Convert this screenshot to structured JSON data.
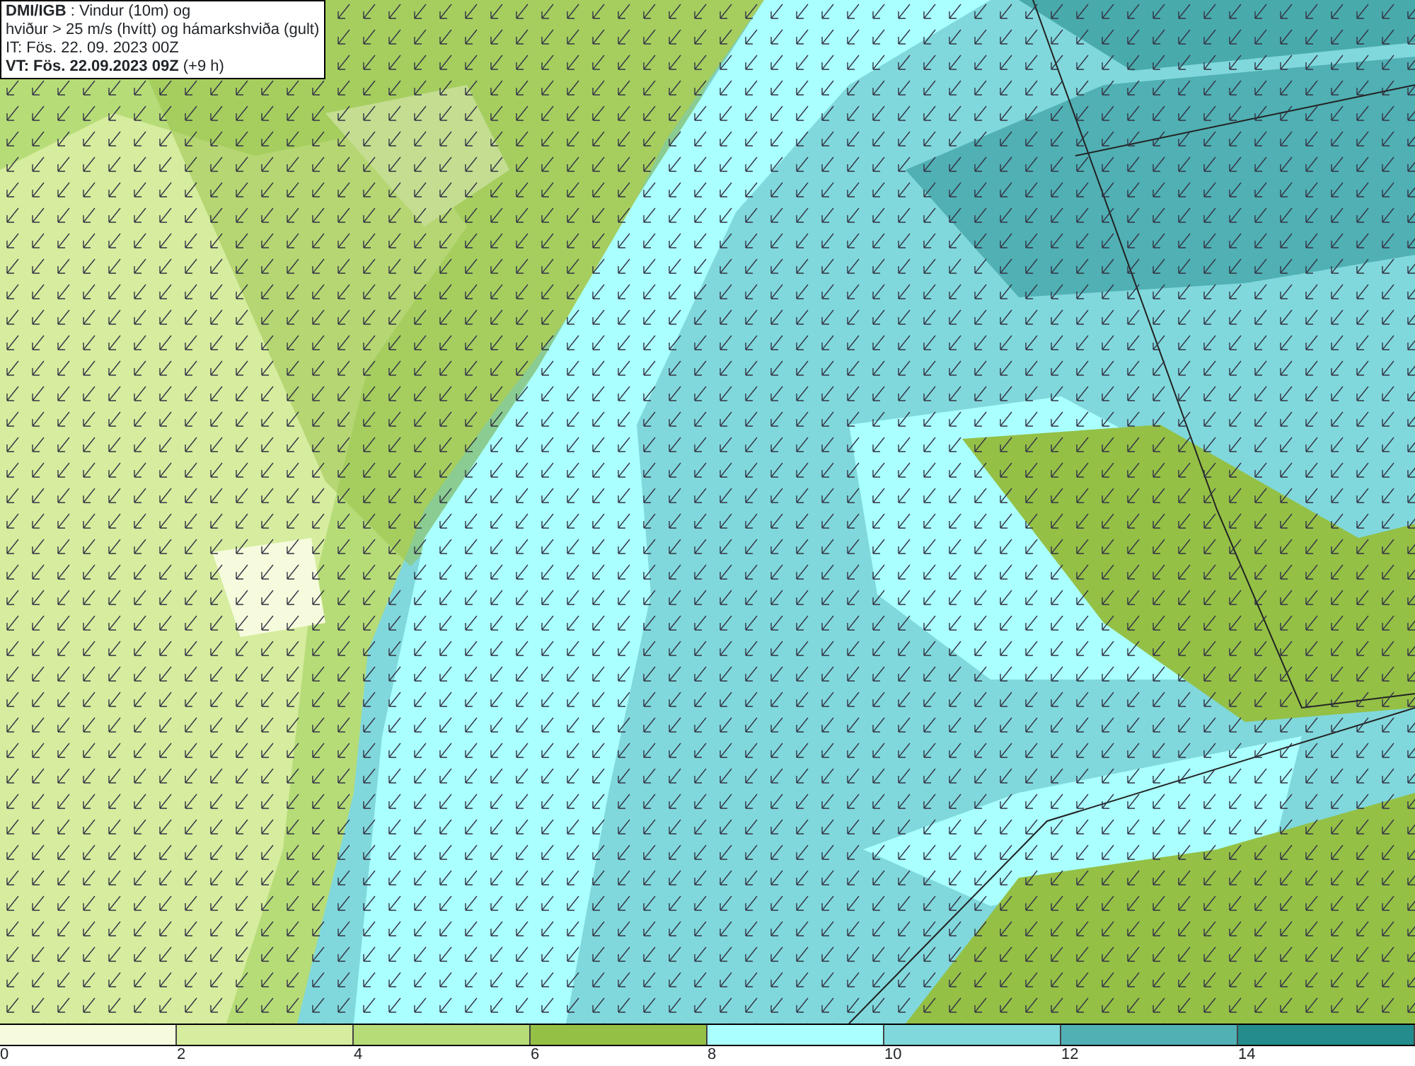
{
  "title_box": {
    "lines": [
      "**DMI/IGB** : Vindur (10m) og",
      "hviður > 25 m/s (hvítt) og hámarkshviða (gult)",
      "IT: Fös. 22. 09. 2023 00Z",
      "**VT: Fös. 22.09.2023 09Z** (+9 h)"
    ]
  },
  "legend": {
    "bins": [
      {
        "color": "#f5fbdc",
        "label": "0"
      },
      {
        "color": "#d6ec9e",
        "label": "2"
      },
      {
        "color": "#b6dc78",
        "label": "4"
      },
      {
        "color": "#94c046",
        "label": "6"
      },
      {
        "color": "#aaffff",
        "label": "8"
      },
      {
        "color": "#80d8dc",
        "label": "10"
      },
      {
        "color": "#50b0b4",
        "label": "12"
      },
      {
        "color": "#248c8c",
        "label": "14"
      }
    ]
  }
}
